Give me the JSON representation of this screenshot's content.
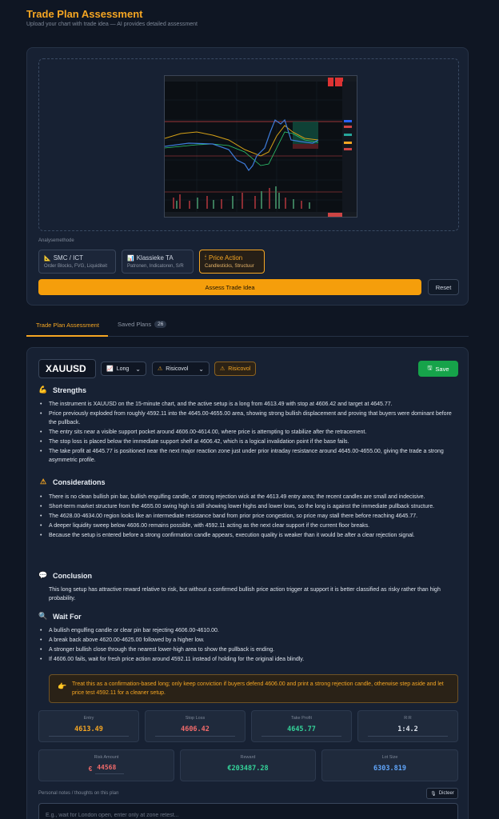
{
  "header": {
    "title": "Trade Plan Assessment",
    "subtitle": "Upload your chart with trade idea — AI provides detailed assessment"
  },
  "upload": {
    "method_label": "Analysemethode",
    "methods": [
      {
        "title": "SMC / ICT",
        "sub": "Order Blocks, FVG, Liquiditeit",
        "icon": "ruler-icon",
        "active": false
      },
      {
        "title": "Klassieke TA",
        "sub": "Patronen, Indicatoren, S/R",
        "icon": "chart-icon",
        "active": false
      },
      {
        "title": "Price Action",
        "sub": "Candlesticks, Structuur",
        "icon": "candle-icon",
        "active": true
      }
    ],
    "assess_label": "Assess Trade Idea",
    "reset_label": "Reset"
  },
  "tabs": {
    "assessment": "Trade Plan Assessment",
    "saved": "Saved Plans",
    "saved_count": "26"
  },
  "result": {
    "symbol": "XAUUSD",
    "direction": "Long",
    "risk_select": "Risicovol",
    "risk_badge": "Risicovol",
    "save_label": "Save",
    "strengths_title": "Strengths",
    "strengths": [
      "The instrument is XAUUSD on the 15-minute chart, and the active setup is a long from 4613.49 with stop at 4606.42 and target at 4645.77.",
      "Price previously exploded from roughly 4592.11 into the 4645.00-4655.00 area, showing strong bullish displacement and proving that buyers were dominant before the pullback.",
      "The entry sits near a visible support pocket around 4606.00-4614.00, where price is attempting to stabilize after the retracement.",
      "The stop loss is placed below the immediate support shelf at 4606.42, which is a logical invalidation point if the base fails.",
      "The take profit at 4645.77 is positioned near the next major reaction zone just under prior intraday resistance around 4645.00-4655.00, giving the trade a strong asymmetric profile."
    ],
    "considerations_title": "Considerations",
    "considerations": [
      "There is no clean bullish pin bar, bullish engulfing candle, or strong rejection wick at the 4613.49 entry area; the recent candles are small and indecisive.",
      "Short-term market structure from the 4655.00 swing high is still showing lower highs and lower lows, so the long is against the immediate pullback structure.",
      "The 4628.00-4634.00 region looks like an intermediate resistance band from prior price congestion, so price may stall there before reaching 4645.77.",
      "A deeper liquidity sweep below 4606.00 remains possible, with 4592.11 acting as the next clear support if the current floor breaks.",
      "Because the setup is entered before a strong confirmation candle appears, execution quality is weaker than it would be after a clear rejection signal."
    ],
    "conclusion_title": "Conclusion",
    "conclusion": "This long setup has attractive reward relative to risk, but without a confirmed bullish price action trigger at support it is better classified as risky rather than high probability.",
    "waitfor_title": "Wait For",
    "waitfor": [
      "A bullish engulfing candle or clear pin bar rejecting 4606.00-4610.00.",
      "A break back above 4620.00-4625.00 followed by a higher low.",
      "A stronger bullish close through the nearest lower-high area to show the pullback is ending.",
      "If 4606.00 fails, wait for fresh price action around 4592.11 instead of holding for the original idea blindly."
    ],
    "tip": "Treat this as a confirmation-based long; only keep conviction if buyers defend 4606.00 and print a strong rejection candle, otherwise step aside and let price test 4592.11 for a cleaner setup.",
    "stats": {
      "entry_label": "Entry",
      "entry": "4613.49",
      "stop_label": "Stop Loss",
      "stop": "4606.42",
      "tp_label": "Take Profit",
      "tp": "4645.77",
      "rr_label": "R:R",
      "rr": "1:4.2",
      "risk_label": "Risk Amount",
      "risk_currency": "€",
      "risk": "44568",
      "reward_label": "Reward",
      "reward": "€203487.28",
      "lot_label": "Lot Size",
      "lot": "6303.819"
    },
    "notes_label": "Personal notes / thoughts on this plan",
    "dicteer_label": "Dicteer",
    "notes_placeholder": "E.g., wait for London open, enter only at zone retest..."
  },
  "colors": {
    "accent": "#f5a623",
    "save": "#16a34a",
    "entry": "#f5a623",
    "stop": "#f26b6b",
    "tp": "#34d399",
    "info": "#60a5fa"
  }
}
